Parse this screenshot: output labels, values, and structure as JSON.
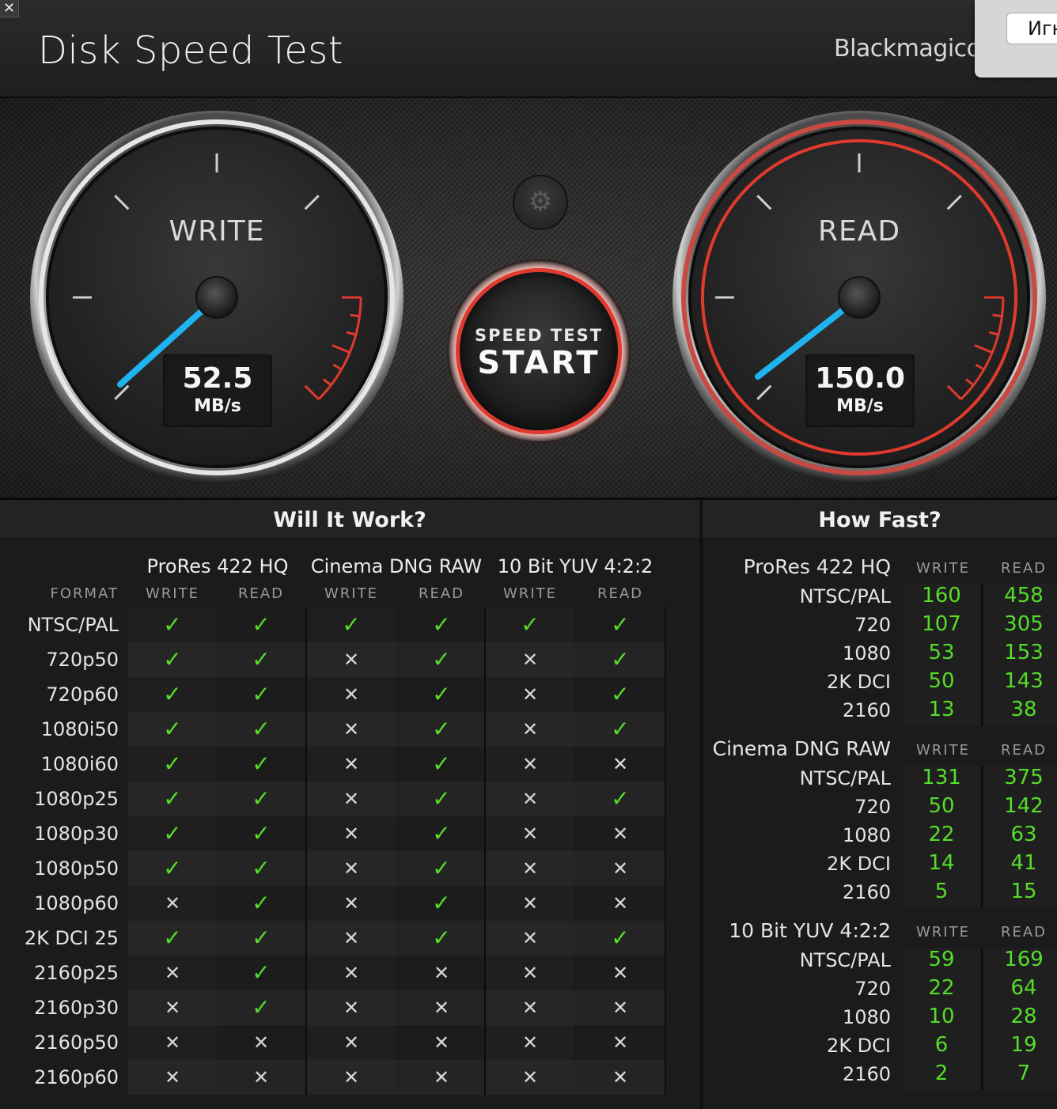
{
  "app": {
    "title": "Disk Speed Test",
    "brand": "Blackmagicdesign",
    "close_glyph": "✕",
    "popup_button": "Игнорировать"
  },
  "gauges": {
    "write": {
      "label": "WRITE",
      "value": "52.5",
      "unit": "MB/s"
    },
    "read": {
      "label": "READ",
      "value": "150.0",
      "unit": "MB/s"
    }
  },
  "start_button": {
    "small": "SPEED TEST",
    "big": "START"
  },
  "settings_icon": "gear-icon",
  "colors": {
    "accent_red": "#e03a2e",
    "needle_blue": "#1fb3f0",
    "ok_green": "#55dd2a"
  },
  "will_it_work": {
    "title": "Will It Work?",
    "format_header": "FORMAT",
    "groups": [
      "ProRes 422 HQ",
      "Cinema DNG RAW",
      "10 Bit YUV 4:2:2"
    ],
    "col_labels": [
      "WRITE",
      "READ"
    ],
    "rows": [
      {
        "label": "NTSC/PAL",
        "vals": [
          1,
          1,
          1,
          1,
          1,
          1
        ]
      },
      {
        "label": "720p50",
        "vals": [
          1,
          1,
          0,
          1,
          0,
          1
        ]
      },
      {
        "label": "720p60",
        "vals": [
          1,
          1,
          0,
          1,
          0,
          1
        ]
      },
      {
        "label": "1080i50",
        "vals": [
          1,
          1,
          0,
          1,
          0,
          1
        ]
      },
      {
        "label": "1080i60",
        "vals": [
          1,
          1,
          0,
          1,
          0,
          0
        ]
      },
      {
        "label": "1080p25",
        "vals": [
          1,
          1,
          0,
          1,
          0,
          1
        ]
      },
      {
        "label": "1080p30",
        "vals": [
          1,
          1,
          0,
          1,
          0,
          0
        ]
      },
      {
        "label": "1080p50",
        "vals": [
          1,
          1,
          0,
          1,
          0,
          0
        ]
      },
      {
        "label": "1080p60",
        "vals": [
          0,
          1,
          0,
          1,
          0,
          0
        ]
      },
      {
        "label": "2K DCI 25",
        "vals": [
          1,
          1,
          0,
          1,
          0,
          1
        ]
      },
      {
        "label": "2160p25",
        "vals": [
          0,
          1,
          0,
          0,
          0,
          0
        ]
      },
      {
        "label": "2160p30",
        "vals": [
          0,
          1,
          0,
          0,
          0,
          0
        ]
      },
      {
        "label": "2160p50",
        "vals": [
          0,
          0,
          0,
          0,
          0,
          0
        ]
      },
      {
        "label": "2160p60",
        "vals": [
          0,
          0,
          0,
          0,
          0,
          0
        ]
      }
    ]
  },
  "how_fast": {
    "title": "How Fast?",
    "col_labels": [
      "WRITE",
      "READ"
    ],
    "groups": [
      {
        "name": "ProRes 422 HQ",
        "rows": [
          {
            "label": "NTSC/PAL",
            "write": "160",
            "read": "458"
          },
          {
            "label": "720",
            "write": "107",
            "read": "305"
          },
          {
            "label": "1080",
            "write": "53",
            "read": "153"
          },
          {
            "label": "2K DCI",
            "write": "50",
            "read": "143"
          },
          {
            "label": "2160",
            "write": "13",
            "read": "38"
          }
        ]
      },
      {
        "name": "Cinema DNG RAW",
        "rows": [
          {
            "label": "NTSC/PAL",
            "write": "131",
            "read": "375"
          },
          {
            "label": "720",
            "write": "50",
            "read": "142"
          },
          {
            "label": "1080",
            "write": "22",
            "read": "63"
          },
          {
            "label": "2K DCI",
            "write": "14",
            "read": "41"
          },
          {
            "label": "2160",
            "write": "5",
            "read": "15"
          }
        ]
      },
      {
        "name": "10 Bit YUV 4:2:2",
        "rows": [
          {
            "label": "NTSC/PAL",
            "write": "59",
            "read": "169"
          },
          {
            "label": "720",
            "write": "22",
            "read": "64"
          },
          {
            "label": "1080",
            "write": "10",
            "read": "28"
          },
          {
            "label": "2K DCI",
            "write": "6",
            "read": "19"
          },
          {
            "label": "2160",
            "write": "2",
            "read": "7"
          }
        ]
      }
    ]
  }
}
